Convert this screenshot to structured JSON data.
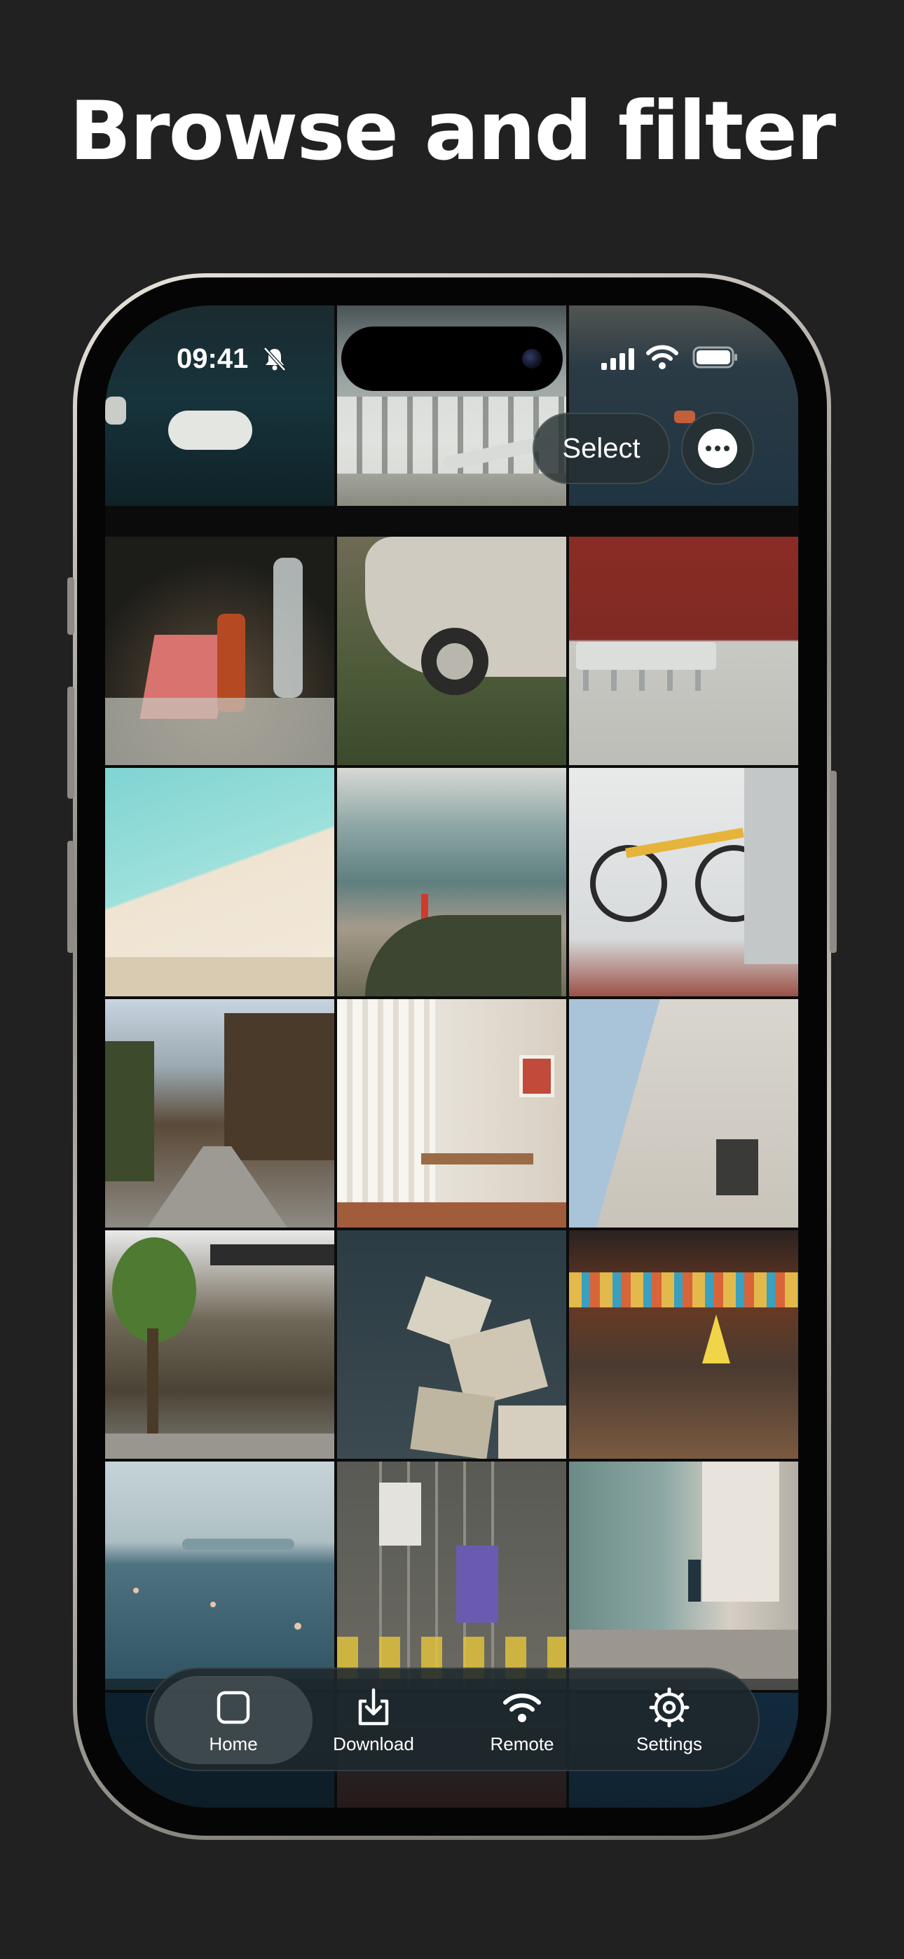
{
  "headline": "Browse and filter",
  "status_bar": {
    "time": "09:41"
  },
  "actions": {
    "select_label": "Select"
  },
  "tabs": [
    {
      "label": "Home",
      "icon": "square-icon",
      "active": true
    },
    {
      "label": "Download",
      "icon": "download-icon",
      "active": false
    },
    {
      "label": "Remote",
      "icon": "wifi-icon",
      "active": false
    },
    {
      "label": "Settings",
      "icon": "gear-icon",
      "active": false
    }
  ],
  "photos": [
    "swan-boat-lake",
    "beach-umbrellas",
    "boat-on-water",
    "ketchup-bottles-table",
    "vintage-car-closeup",
    "red-wall-chairs",
    "pool-aerial",
    "coast-lighthouse",
    "yellow-bicycle",
    "kyoto-street",
    "dining-room",
    "arch-building",
    "japanese-shop-tree",
    "rocks-sea",
    "bookstore-interior",
    "swimmers-lake",
    "tram-street-aerial",
    "alley-buildings"
  ]
}
